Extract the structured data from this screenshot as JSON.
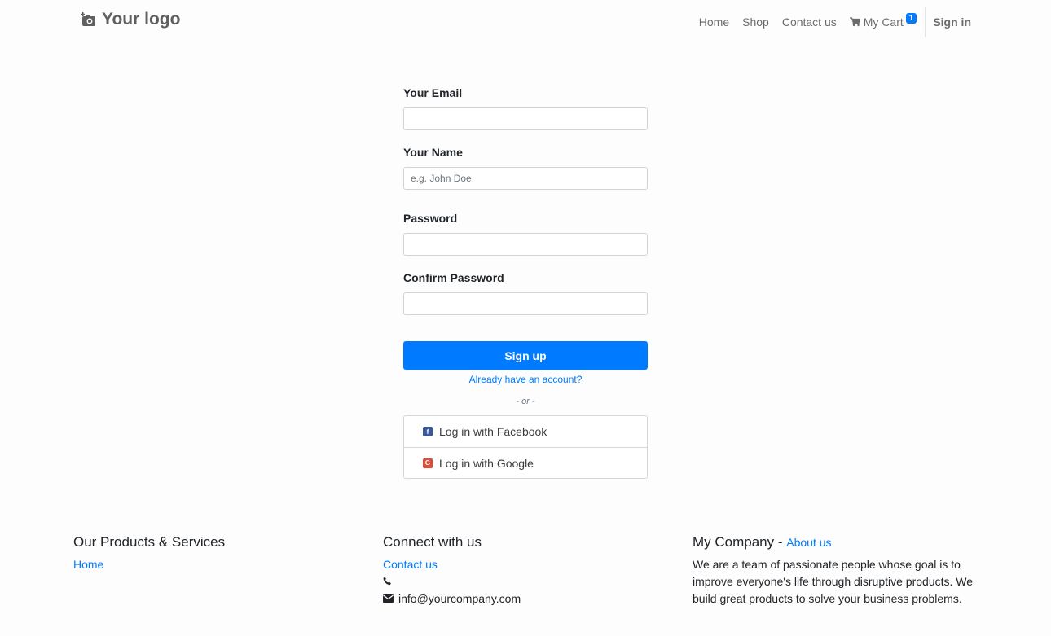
{
  "header": {
    "logo_text": "Your logo",
    "nav": [
      {
        "label": "Home"
      },
      {
        "label": "Shop"
      },
      {
        "label": "Contact us"
      },
      {
        "label": "My Cart",
        "badge": "1"
      }
    ],
    "signin_label": "Sign in"
  },
  "form": {
    "email": {
      "label": "Your Email",
      "value": "",
      "placeholder": ""
    },
    "name": {
      "label": "Your Name",
      "value": "",
      "placeholder": "e.g. John Doe"
    },
    "password": {
      "label": "Password",
      "value": "",
      "placeholder": ""
    },
    "confirm_password": {
      "label": "Confirm Password",
      "value": "",
      "placeholder": ""
    },
    "submit_label": "Sign up",
    "already_link": "Already have an account?",
    "or_text": "- or -",
    "social": [
      {
        "label": "Log in with Facebook",
        "icon": "facebook-icon",
        "color": "#3b5998"
      },
      {
        "label": "Log in with Google",
        "icon": "google-plus-icon",
        "color": "#dd4b39"
      }
    ]
  },
  "footer": {
    "products": {
      "title": "Our Products & Services",
      "links": [
        "Home"
      ]
    },
    "connect": {
      "title": "Connect with us",
      "contact_link": "Contact us",
      "phone": "",
      "email": "info@yourcompany.com"
    },
    "company": {
      "title": "My Company",
      "separator": " - ",
      "about_link": "About us",
      "description": "We are a team of passionate people whose goal is to improve everyone's life through disruptive products. We build great products to solve your business problems."
    }
  },
  "colors": {
    "primary": "#007bff",
    "facebook": "#3b5998",
    "google": "#dd4b39"
  }
}
